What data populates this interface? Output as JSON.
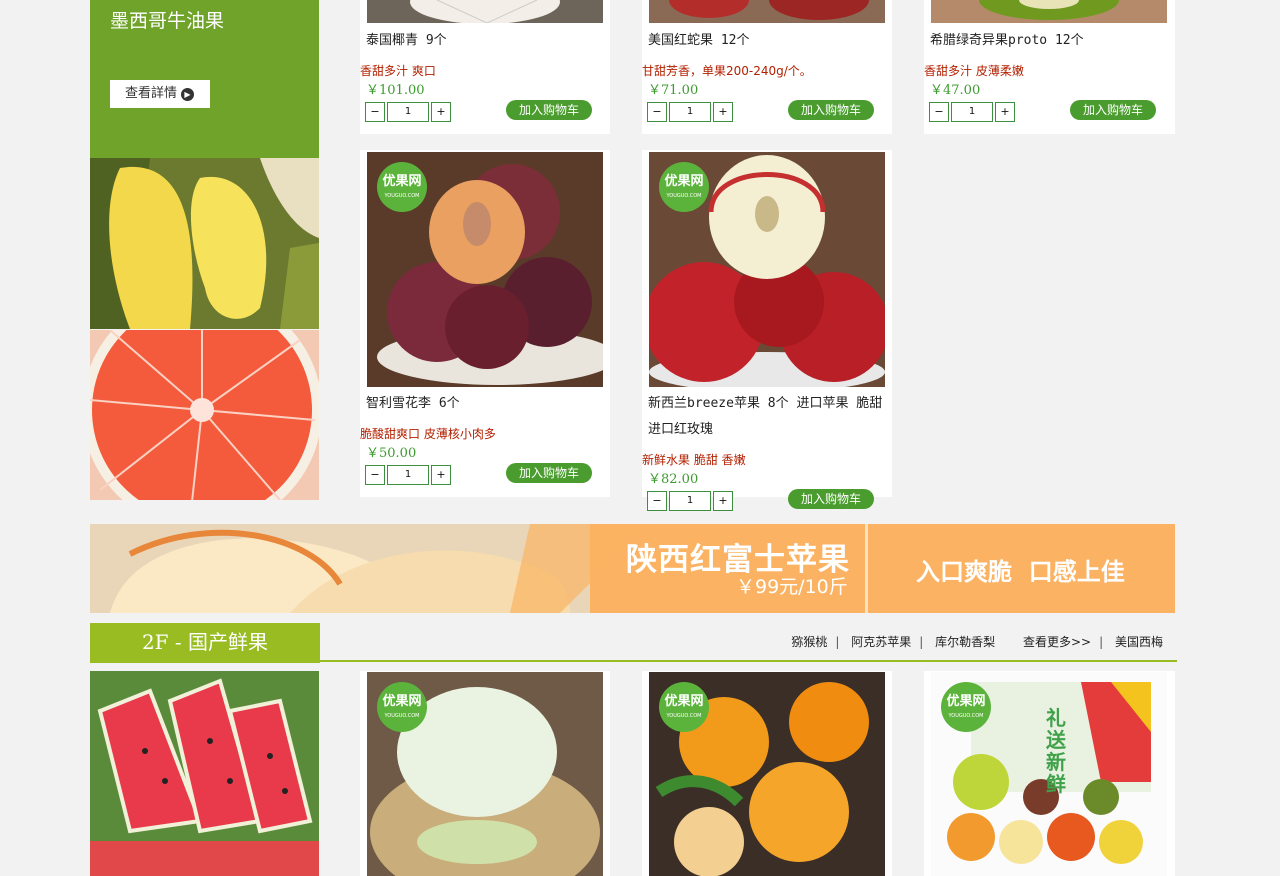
{
  "left_promo": {
    "title": "墨西哥牛油果",
    "detail_button": "查看詳情"
  },
  "products": [
    {
      "name": "泰国椰青 9个",
      "desc": "香甜多汁 爽口",
      "price": "￥101.00",
      "qty": "1",
      "cart": "加入购物车"
    },
    {
      "name": "美国红蛇果 12个",
      "desc": "甘甜芳香，单果200-240g/个。",
      "price": "￥71.00",
      "qty": "1",
      "cart": "加入购物车"
    },
    {
      "name": "希腊绿奇异果proto 12个",
      "desc": "香甜多汁 皮薄柔嫩",
      "price": "￥47.00",
      "qty": "1",
      "cart": "加入购物车"
    },
    {
      "name": "智利雪花李 6个",
      "desc": "脆酸甜爽口 皮薄核小肉多",
      "price": "￥50.00",
      "qty": "1",
      "cart": "加入购物车"
    },
    {
      "name_line1": "新西兰breeze苹果 8个 进口苹果 脆甜",
      "name_line2": "进口红玫瑰",
      "desc": "新鲜水果 脆甜 香嫩",
      "price": "￥82.00",
      "qty": "1",
      "cart": "加入购物车"
    }
  ],
  "qty_controls": {
    "minus": "−",
    "plus": "+"
  },
  "logo": {
    "text": "优果网",
    "sub": "YOUGUO.COM"
  },
  "banner": {
    "title": "陕西红富士苹果",
    "price": "￥99元/10斤",
    "slogan": "入口爽脆  口感上佳"
  },
  "floor": {
    "title": "2F - 国产鲜果",
    "links": [
      "猕猴桃",
      "阿克苏苹果",
      "库尔勒香梨",
      "查看更多>>",
      "美国西梅"
    ]
  },
  "gift_box": {
    "text": "礼送新鲜"
  }
}
